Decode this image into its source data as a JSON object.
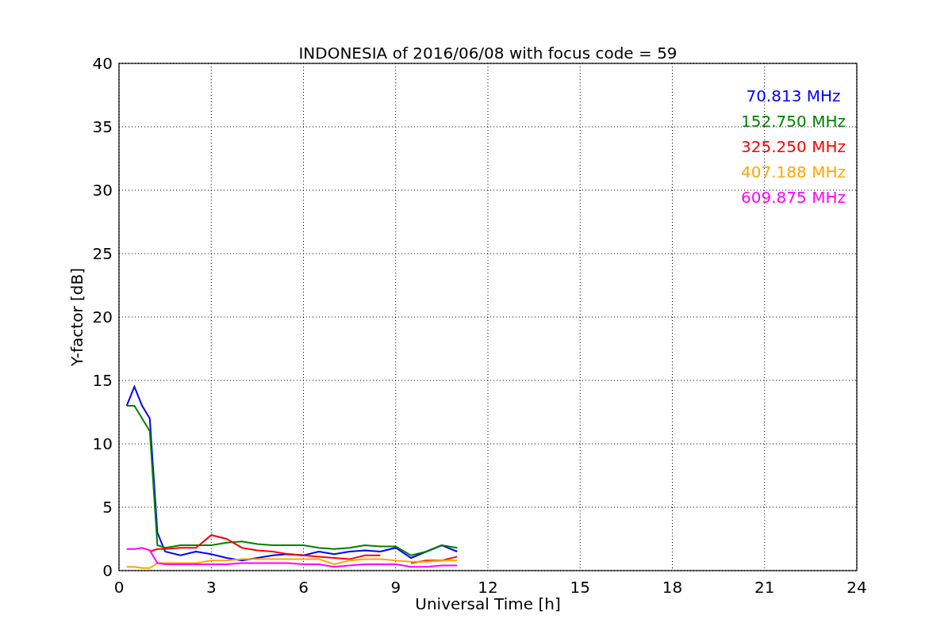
{
  "figure": {
    "chart_data": {
      "type": "line",
      "title": "INDONESIA of 2016/06/08 with focus code = 59",
      "xlabel": "Universal Time [h]",
      "ylabel": "Y-factor [dB]",
      "x": [
        0.25,
        0.5,
        0.75,
        1.0,
        1.25,
        1.5,
        2,
        2.5,
        3,
        3.5,
        4,
        4.5,
        5,
        5.5,
        6,
        6.5,
        7,
        7.5,
        8,
        8.5,
        9,
        9.5,
        10,
        10.5,
        11
      ],
      "series": [
        {
          "name": "70.813 MHz",
          "color": "#0000ff",
          "values": [
            13,
            14.5,
            13,
            12,
            3,
            1.5,
            1.2,
            1.5,
            1.3,
            1,
            0.8,
            1,
            1.2,
            1.3,
            1.2,
            1.5,
            1.3,
            1.5,
            1.6,
            1.5,
            1.8,
            1,
            1.5,
            2,
            1.5
          ]
        },
        {
          "name": "152.750 MHz",
          "color": "#008000",
          "values": [
            13,
            13,
            12,
            11,
            2,
            1.8,
            2,
            2,
            2,
            2.2,
            2.3,
            2.1,
            2,
            2,
            2,
            1.8,
            1.7,
            1.8,
            2,
            1.9,
            1.9,
            1.2,
            1.5,
            2,
            1.8
          ]
        },
        {
          "name": "325.250 MHz",
          "color": "#ff0000",
          "values": [
            null,
            null,
            null,
            1.5,
            1.7,
            1.7,
            1.8,
            1.8,
            2.8,
            2.5,
            1.8,
            1.6,
            1.5,
            1.3,
            1.2,
            1.1,
            1,
            0.9,
            1.2,
            1.2,
            null,
            0.6,
            0.8,
            0.8,
            1.1
          ]
        },
        {
          "name": "407.188 MHz",
          "color": "#ffa500",
          "values": [
            0.3,
            0.3,
            0.2,
            0.2,
            0.6,
            0.6,
            0.6,
            0.6,
            0.8,
            0.8,
            0.9,
            0.9,
            0.9,
            0.9,
            0.9,
            0.9,
            0.5,
            0.8,
            0.9,
            0.9,
            0.8,
            0.7,
            0.7,
            0.8,
            0.8
          ]
        },
        {
          "name": "609.875 MHz",
          "color": "#ff00ff",
          "values": [
            1.7,
            1.7,
            1.8,
            1.6,
            0.6,
            0.5,
            0.5,
            0.5,
            0.5,
            0.5,
            0.6,
            0.6,
            0.6,
            0.6,
            0.5,
            0.5,
            0.3,
            0.4,
            0.5,
            0.5,
            0.5,
            0.3,
            0.3,
            0.4,
            0.4
          ]
        }
      ],
      "grid": true,
      "xlim": [
        0,
        24
      ],
      "ylim": [
        0,
        40
      ],
      "xticks": [
        0,
        3,
        6,
        9,
        12,
        15,
        18,
        21,
        24
      ],
      "yticks": [
        0,
        5,
        10,
        15,
        20,
        25,
        30,
        35,
        40
      ]
    }
  }
}
